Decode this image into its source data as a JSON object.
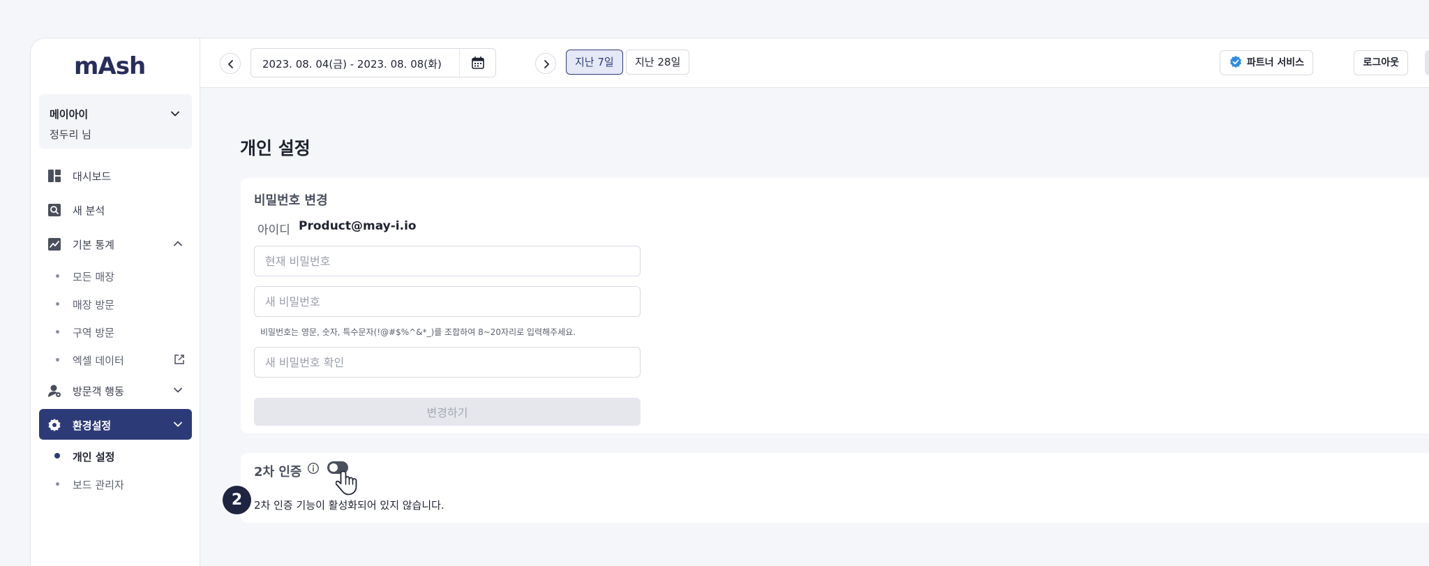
{
  "brand": {
    "logo_text": "mAsh"
  },
  "account": {
    "org": "메이아이",
    "user": "정두리 님"
  },
  "sidebar": {
    "items": [
      {
        "label": "대시보드",
        "icon": "dashboard-icon"
      },
      {
        "label": "새 분석",
        "icon": "search-icon"
      },
      {
        "label": "기본 통계",
        "icon": "chart-icon"
      },
      {
        "label": "방문객 행동",
        "icon": "visitor-icon"
      },
      {
        "label": "환경설정",
        "icon": "gear-icon"
      }
    ],
    "stats_sub": [
      "모든 매장",
      "매장 방문",
      "구역 방문",
      "엑셀 데이터"
    ],
    "settings_sub": [
      "개인 설정",
      "보드 관리자"
    ]
  },
  "topbar": {
    "date_range": "2023. 08. 04(금) - 2023. 08. 08(화)",
    "ranges": [
      "지난 7일",
      "지난 28일"
    ],
    "partner_label": "파트너 서비스",
    "logout_label": "로그아웃"
  },
  "page": {
    "title": "개인 설정",
    "password": {
      "section_title": "비밀번호 변경",
      "id_label": "아이디",
      "id_value": "Product@may-i.io",
      "current_placeholder": "현재 비밀번호",
      "new_placeholder": "새 비밀번호",
      "hint": "비밀번호는 영문, 숫자, 특수문자(!@#$%^&*_)를 조합하여 8~20자리로 입력해주세요.",
      "confirm_placeholder": "새 비밀번호 확인",
      "submit_label": "변경하기"
    },
    "twofa": {
      "step": "2",
      "title": "2차 인증",
      "description": "2차 인증 기능이 활성화되어 있지 않습니다.",
      "enabled": false
    }
  },
  "colors": {
    "accent": "#2d3a78",
    "step_badge": "#1f2540"
  }
}
